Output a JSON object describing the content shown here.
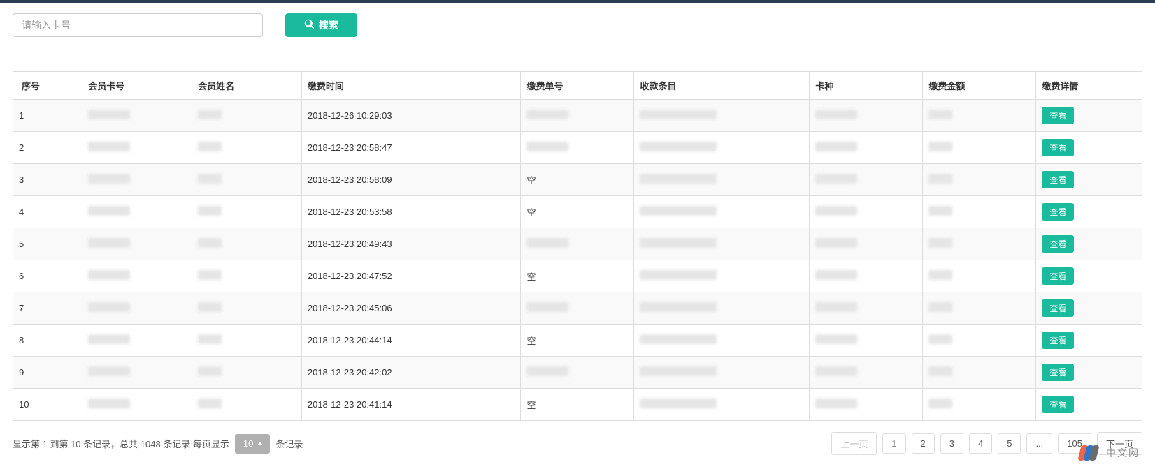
{
  "search": {
    "placeholder": "请输入卡号",
    "button_label": "搜索"
  },
  "table": {
    "headers": {
      "index": "序号",
      "card_no": "会员卡号",
      "member_name": "会员姓名",
      "pay_time": "缴费时间",
      "order_no": "缴费单号",
      "pay_item": "收款条目",
      "card_type": "卡种",
      "amount": "缴费金额",
      "action": "缴费详情"
    },
    "action_label": "查看",
    "rows": [
      {
        "index": 1,
        "card_no": "",
        "member_name": "",
        "pay_time": "2018-12-26 10:29:03",
        "order_no": "",
        "pay_item": "",
        "card_type": "",
        "amount": ""
      },
      {
        "index": 2,
        "card_no": "",
        "member_name": "",
        "pay_time": "2018-12-23 20:58:47",
        "order_no": "",
        "pay_item": "",
        "card_type": "",
        "amount": ""
      },
      {
        "index": 3,
        "card_no": "",
        "member_name": "",
        "pay_time": "2018-12-23 20:58:09",
        "order_no": "空",
        "pay_item": "",
        "card_type": "",
        "amount": ""
      },
      {
        "index": 4,
        "card_no": "",
        "member_name": "",
        "pay_time": "2018-12-23 20:53:58",
        "order_no": "空",
        "pay_item": "",
        "card_type": "",
        "amount": ""
      },
      {
        "index": 5,
        "card_no": "",
        "member_name": "",
        "pay_time": "2018-12-23 20:49:43",
        "order_no": "",
        "pay_item": "",
        "card_type": "",
        "amount": ""
      },
      {
        "index": 6,
        "card_no": "",
        "member_name": "",
        "pay_time": "2018-12-23 20:47:52",
        "order_no": "空",
        "pay_item": "",
        "card_type": "",
        "amount": ""
      },
      {
        "index": 7,
        "card_no": "",
        "member_name": "",
        "pay_time": "2018-12-23 20:45:06",
        "order_no": "",
        "pay_item": "",
        "card_type": "",
        "amount": ""
      },
      {
        "index": 8,
        "card_no": "",
        "member_name": "",
        "pay_time": "2018-12-23 20:44:14",
        "order_no": "空",
        "pay_item": "",
        "card_type": "",
        "amount": ""
      },
      {
        "index": 9,
        "card_no": "",
        "member_name": "",
        "pay_time": "2018-12-23 20:42:02",
        "order_no": "",
        "pay_item": "",
        "card_type": "",
        "amount": ""
      },
      {
        "index": 10,
        "card_no": "",
        "member_name": "",
        "pay_time": "2018-12-23 20:41:14",
        "order_no": "空",
        "pay_item": "",
        "card_type": "",
        "amount": ""
      }
    ]
  },
  "footer": {
    "info_prefix": "显示第 1 到第 10 条记录，总共 1048 条记录 每页显示",
    "pageSize": "10",
    "info_suffix": "条记录",
    "pagination": {
      "prev": "上一页",
      "next": "下一页",
      "pages": [
        "1",
        "2",
        "3",
        "4",
        "5",
        "...",
        "105"
      ],
      "active_index": 0
    }
  },
  "watermark": "中文网"
}
